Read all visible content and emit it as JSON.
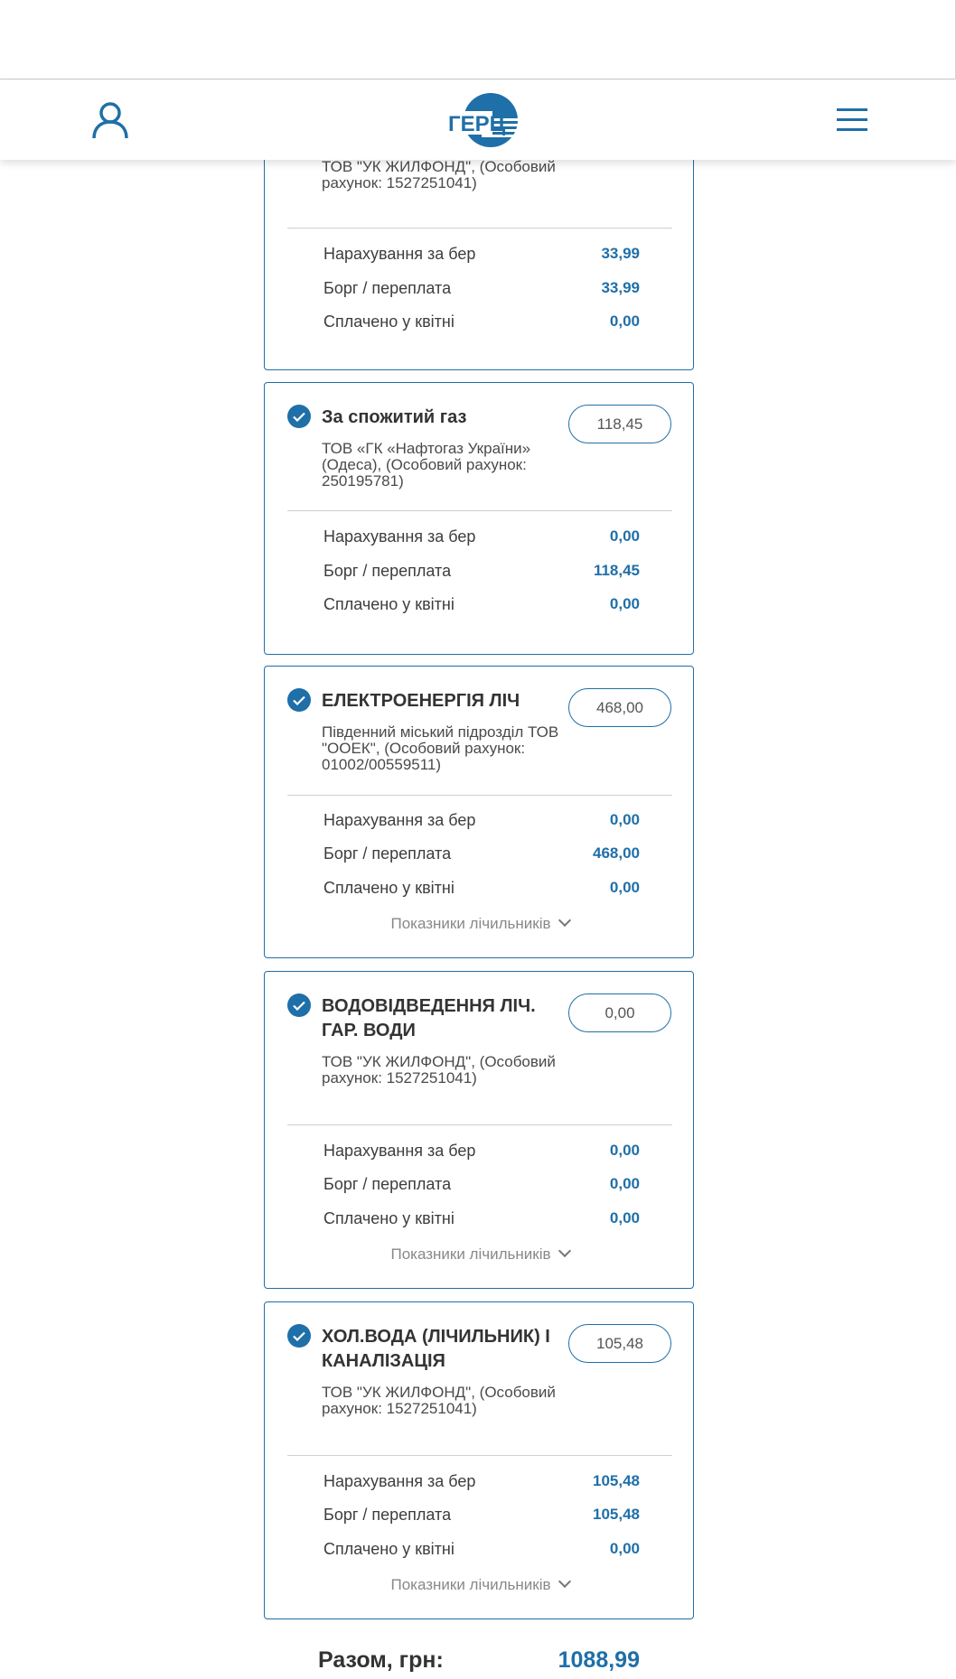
{
  "header": {
    "user_icon": "user-icon",
    "logo_text": "ГЕРЦ",
    "menu_icon": "hamburger-menu-icon"
  },
  "cards": [
    {
      "title": "",
      "provider": "ТОВ \"УК ЖИЛФОНД\", (Особовий рахунок: 1527251041)",
      "amount": "",
      "rows": [
        {
          "label": "Нарахування за бер",
          "value": "33,99"
        },
        {
          "label": "Борг / переплата",
          "value": "33,99"
        },
        {
          "label": "Сплачено у квітні",
          "value": "0,00"
        }
      ]
    },
    {
      "title": "За спожитий газ",
      "provider": "ТОВ «ГК «Нафтогаз України» (Одеса), (Особовий рахунок: 250195781)",
      "amount": "118,45",
      "rows": [
        {
          "label": "Нарахування за бер",
          "value": "0,00"
        },
        {
          "label": "Борг / переплата",
          "value": "118,45"
        },
        {
          "label": "Сплачено у квітні",
          "value": "0,00"
        }
      ]
    },
    {
      "title": "ЕЛЕКТРОЕНЕРГІЯ ЛІЧ",
      "provider": "Південний міський підрозділ ТОВ \"ООЕК\", (Особовий рахунок: 01002/00559511)",
      "amount": "468,00",
      "rows": [
        {
          "label": "Нарахування за бер",
          "value": "0,00"
        },
        {
          "label": "Борг / переплата",
          "value": "468,00"
        },
        {
          "label": "Сплачено у квітні",
          "value": "0,00"
        }
      ],
      "meters_label": "Показники лічильників"
    },
    {
      "title": "ВОДОВІДВЕДЕННЯ ЛІЧ. ГАР. ВОДИ",
      "provider": "ТОВ \"УК ЖИЛФОНД\", (Особовий рахунок: 1527251041)",
      "amount": "0,00",
      "rows": [
        {
          "label": "Нарахування за бер",
          "value": "0,00"
        },
        {
          "label": "Борг / переплата",
          "value": "0,00"
        },
        {
          "label": "Сплачено у квітні",
          "value": "0,00"
        }
      ],
      "meters_label": "Показники лічильників"
    },
    {
      "title": "ХОЛ.ВОДА (ЛІЧИЛЬНИК) І КАНАЛІЗАЦІЯ",
      "provider": "ТОВ \"УК ЖИЛФОНД\", (Особовий рахунок: 1527251041)",
      "amount": "105,48",
      "rows": [
        {
          "label": "Нарахування за бер",
          "value": "105,48"
        },
        {
          "label": "Борг / переплата",
          "value": "105,48"
        },
        {
          "label": "Сплачено у квітні",
          "value": "0,00"
        }
      ],
      "meters_label": "Показники лічильників"
    }
  ],
  "total": {
    "label": "Разом, грн:",
    "value": "1088,99"
  },
  "colors": {
    "accent": "#1f6fa8",
    "text": "#333333"
  }
}
